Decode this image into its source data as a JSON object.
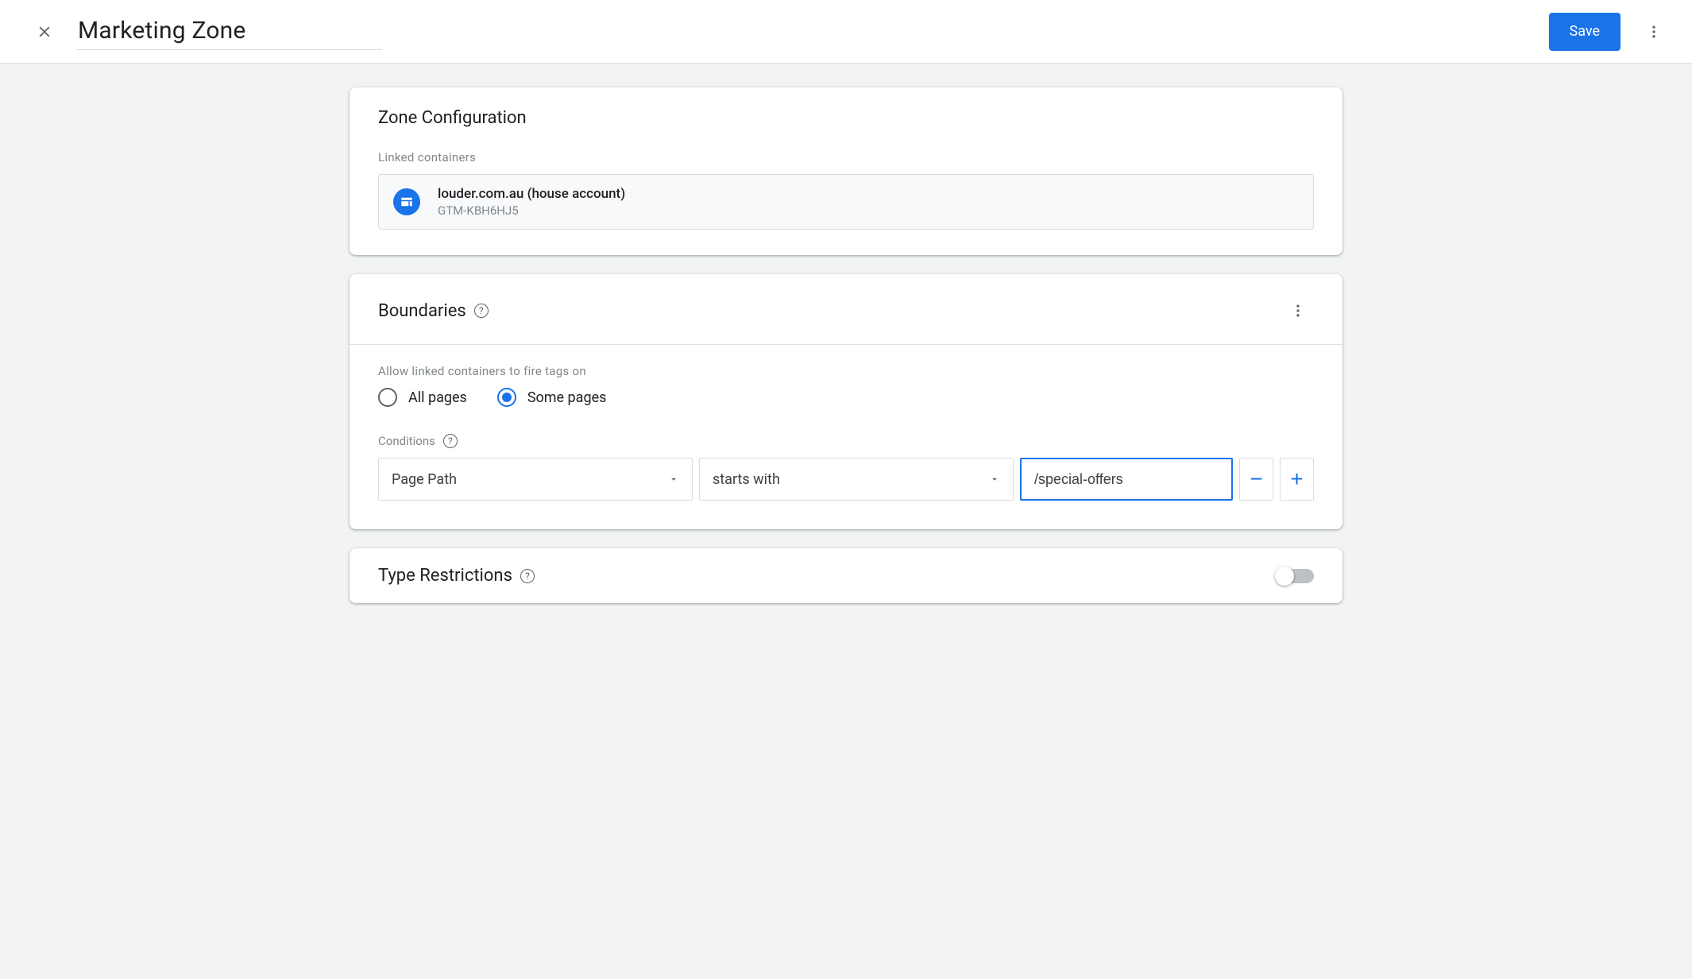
{
  "header": {
    "title": "Marketing Zone",
    "save_label": "Save"
  },
  "zone_configuration": {
    "title": "Zone Configuration",
    "linked_label": "Linked containers",
    "container": {
      "name": "louder.com.au (house account)",
      "id": "GTM-KBH6HJ5"
    }
  },
  "boundaries": {
    "title": "Boundaries",
    "allow_label": "Allow linked containers to fire tags on",
    "radio_all": "All pages",
    "radio_some": "Some pages",
    "selected": "some",
    "conditions_label": "Conditions",
    "condition": {
      "variable": "Page Path",
      "operator": "starts with",
      "value": "/special-offers"
    }
  },
  "type_restrictions": {
    "title": "Type Restrictions",
    "enabled": false
  }
}
